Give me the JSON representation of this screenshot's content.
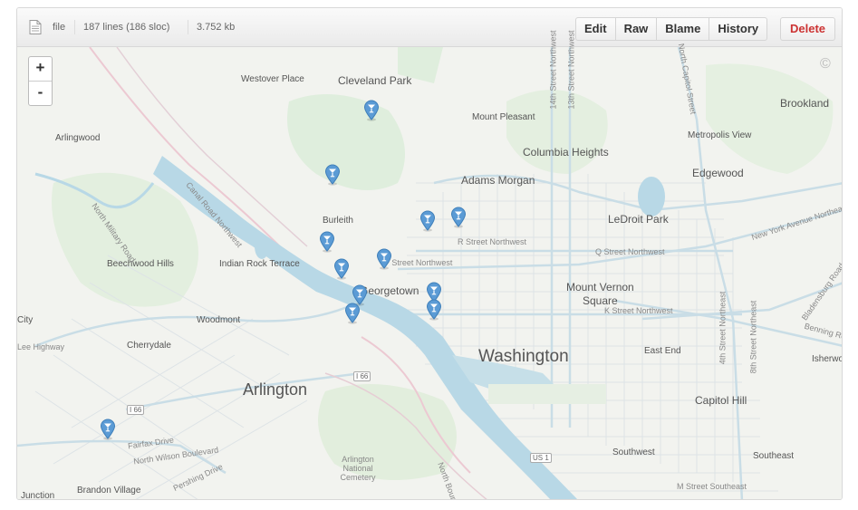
{
  "header": {
    "file_label": "file",
    "lines": "187 lines (186 sloc)",
    "size": "3.752 kb",
    "buttons": {
      "edit": "Edit",
      "raw": "Raw",
      "blame": "Blame",
      "history": "History",
      "delete": "Delete"
    }
  },
  "map": {
    "zoom_in": "+",
    "zoom_out": "-",
    "copyright": "©",
    "labels": {
      "westover_place": "Westover Place",
      "cleveland_park": "Cleveland Park",
      "mount_pleasant": "Mount Pleasant",
      "brookland": "Brookland",
      "arlingwood": "Arlingwood",
      "metropolis_view": "Metropolis View",
      "columbia_heights": "Columbia Heights",
      "edgewood": "Edgewood",
      "adams_morgan": "Adams Morgan",
      "ledroit_park": "LeDroit Park",
      "burleith": "Burleith",
      "beechwood_hills": "Beechwood Hills",
      "indian_rock_terrace": "Indian Rock Terrace",
      "georgetown": "Georgetown",
      "mount_vernon_square": "Mount Vernon",
      "square": "Square",
      "woodmont": "Woodmont",
      "city": "City",
      "cherrydale": "Cherrydale",
      "washington": "Washington",
      "east_end": "East End",
      "arlington": "Arlington",
      "capitol_hill": "Capitol Hill",
      "isherwood": "Isherwo",
      "southwest": "Southwest",
      "southeast": "Southeast",
      "arlington_cemetery": "Arlington National Cemetery",
      "brandon_village": "Brandon Village",
      "junction": "Junction",
      "r_street": "R Street Northwest",
      "p_street": "P Street Northwest",
      "q_street": "Q Street Northwest",
      "k_street": "K Street Northwest",
      "m_street": "M Street Southeast",
      "fairfax_drive": "Fairfax Drive",
      "north_wilson": "North Wilson Boulevard",
      "pershing_drive": "Pershing Drive",
      "lee_highway": "Lee Highway",
      "canal_road": "Canal Road Northwest",
      "military_road": "North Military Road",
      "new_york_ave": "New York Avenue Northeast",
      "bladensburg": "Bladensburg Road",
      "benning_road": "Benning Road",
      "street_14": "14th Street Northwest",
      "street_13": "13th Street Northwest",
      "street_4": "4th Street Northeast",
      "street_8": "8th Street Northeast",
      "north_capitol": "North Capitol Street",
      "north_bound": "North Boun",
      "i66_a": "I 66",
      "i66_b": "I 66",
      "us1": "US 1"
    },
    "markers": [
      {
        "name": "marker-mount-pleasant",
        "lat": 38.9312,
        "lng": -77.0345
      },
      {
        "name": "marker-adams-morgan",
        "lat": 38.9218,
        "lng": -77.0425
      },
      {
        "name": "marker-ledroit-1",
        "lat": 38.915,
        "lng": -77.023
      },
      {
        "name": "marker-ledroit-2",
        "lat": 38.9155,
        "lng": -77.0167
      },
      {
        "name": "marker-dupont-1",
        "lat": 38.912,
        "lng": -77.0437
      },
      {
        "name": "marker-dupont-2",
        "lat": 38.908,
        "lng": -77.0406
      },
      {
        "name": "marker-logan",
        "lat": 38.9095,
        "lng": -77.032
      },
      {
        "name": "marker-downtown-1",
        "lat": 38.9042,
        "lng": -77.037
      },
      {
        "name": "marker-downtown-2",
        "lat": 38.9015,
        "lng": -77.0385
      },
      {
        "name": "marker-mvsq-1",
        "lat": 38.9046,
        "lng": -77.0218
      },
      {
        "name": "marker-mvsq-2",
        "lat": 38.902,
        "lng": -77.0218
      },
      {
        "name": "marker-arlington",
        "lat": 38.8845,
        "lng": -77.0885
      }
    ]
  }
}
